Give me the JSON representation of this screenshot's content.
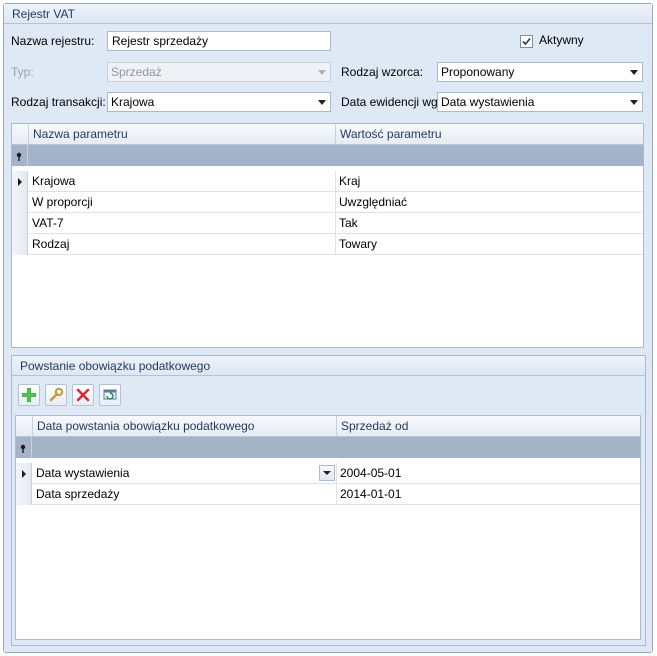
{
  "panel": {
    "title": "Rejestr VAT"
  },
  "form": {
    "nazwa_label": "Nazwa rejestru:",
    "nazwa_value": "Rejestr sprzedaży",
    "aktywny_label": "Aktywny",
    "aktywny_checked": true,
    "typ_label": "Typ:",
    "typ_value": "Sprzedaż",
    "rodzaj_wzorca_label": "Rodzaj wzorca:",
    "rodzaj_wzorca_value": "Proponowany",
    "rodzaj_transakcji_label": "Rodzaj transakcji:",
    "rodzaj_transakcji_value": "Krajowa",
    "data_ewidencji_label": "Data ewidencji wg:",
    "data_ewidencji_value": "Data wystawienia"
  },
  "params_grid": {
    "columns": [
      "Nazwa parametru",
      "Wartość parametru"
    ],
    "rows": [
      [
        "Krajowa",
        "Kraj"
      ],
      [
        "W proporcji",
        "Uwzględniać"
      ],
      [
        "VAT-7",
        "Tak"
      ],
      [
        "Rodzaj",
        "Towary"
      ]
    ]
  },
  "tax_section": {
    "title": "Powstanie obowiązku podatkowego",
    "toolbar": [
      "add-icon",
      "wrench-icon",
      "delete-icon",
      "refresh-icon"
    ],
    "columns": [
      "Data powstania obowiązku podatkowego",
      "Sprzedaż od"
    ],
    "rows": [
      [
        "Data wystawienia",
        "2004-05-01"
      ],
      [
        "Data sprzedaży",
        "2014-01-01"
      ]
    ]
  },
  "colors": {
    "panel_bg": "#dfe8f5",
    "header_text": "#1e395b",
    "filter_row": "#a4b3c8",
    "add_green": "#3aa336",
    "delete_red": "#d92b2b"
  }
}
